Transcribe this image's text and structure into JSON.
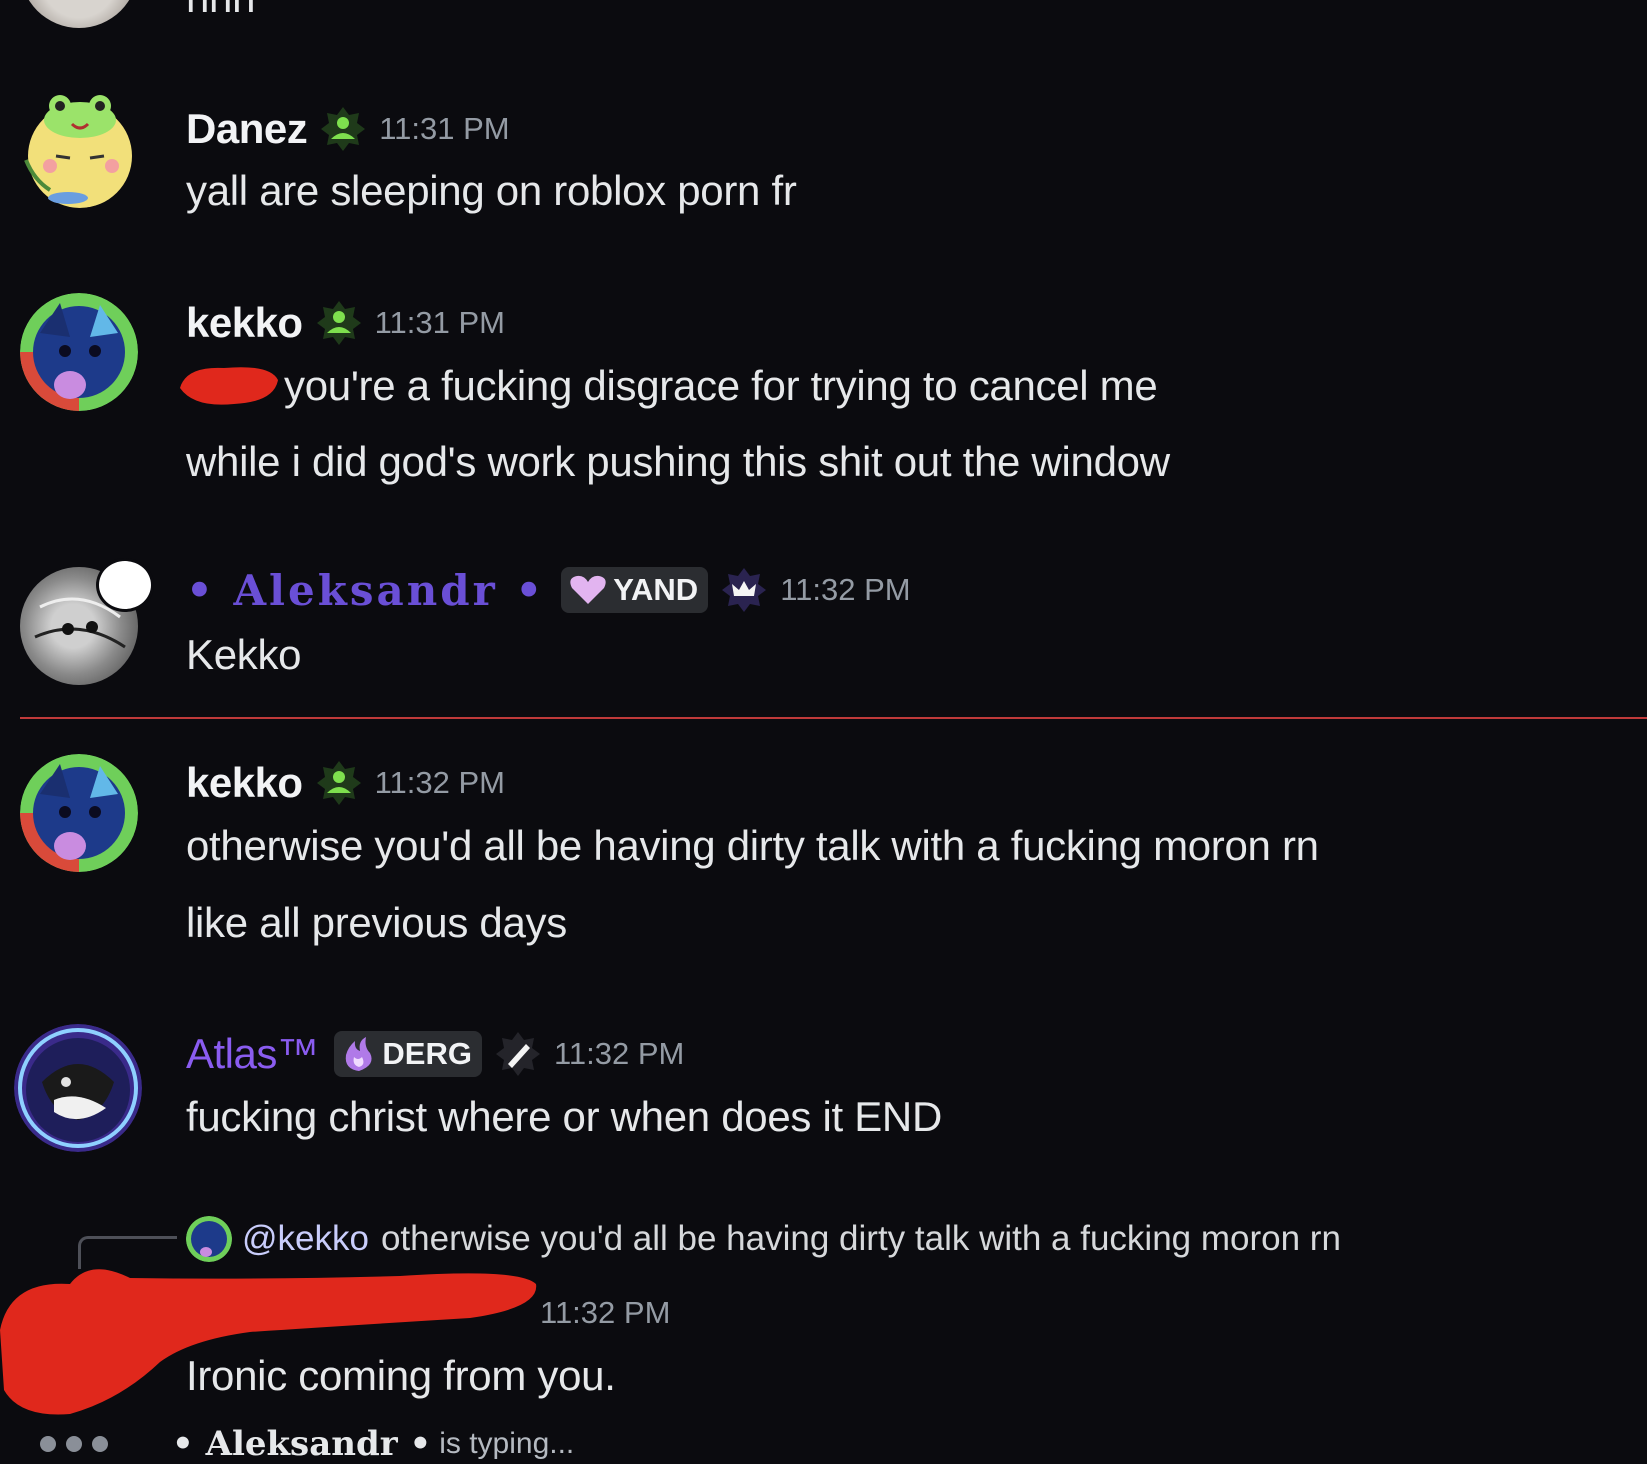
{
  "top_partial": {
    "text": "nnn"
  },
  "messages": [
    {
      "author": "Danez",
      "time": "11:31 PM",
      "lines": [
        "yall are sleeping on roblox porn fr"
      ],
      "role_icon": "green-person-badge-icon"
    },
    {
      "author": "kekko",
      "time": "11:31 PM",
      "lines": [
        "you're a fucking disgrace for trying to cancel me",
        "while i did god's work pushing this shit out the window"
      ],
      "role_icon": "green-person-badge-icon"
    },
    {
      "author": "• Aleksandr •",
      "time": "11:32 PM",
      "tag": "YAND",
      "tag_icon": "heart-icon",
      "role_icon": "crown-badge-icon",
      "lines": [
        "Kekko"
      ]
    },
    {
      "author": "kekko",
      "time": "11:32 PM",
      "lines": [
        "otherwise you'd all be having dirty talk with a fucking moron rn",
        "like all previous days"
      ],
      "role_icon": "green-person-badge-icon"
    },
    {
      "author": "Atlas™",
      "time": "11:32 PM",
      "tag": "DERG",
      "tag_icon": "flame-icon",
      "role_icon": "brush-badge-icon",
      "lines": [
        "fucking christ where or when does it END"
      ]
    },
    {
      "reply_mention": "@kekko",
      "reply_text": "otherwise you'd all be having dirty talk with a fucking moron rn",
      "time": "11:32 PM",
      "lines": [
        "Ironic coming from you."
      ]
    }
  ],
  "typing": {
    "name": "• Aleksandr •",
    "text": "is typing..."
  },
  "colors": {
    "background": "#0b0b0f",
    "aleksandr": "#6a4fd6",
    "atlas": "#8a5cf0",
    "mention": "#c9cdfb",
    "new_divider": "#c03a3a",
    "redaction": "#e0281c"
  }
}
